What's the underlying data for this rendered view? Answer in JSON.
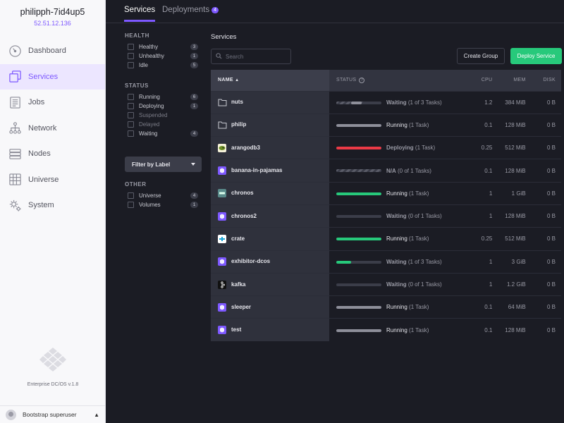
{
  "cluster": {
    "name": "philipph-7id4up5",
    "ip": "52.51.12.136"
  },
  "nav": [
    {
      "label": "Dashboard",
      "icon": "dashboard-icon",
      "active": false
    },
    {
      "label": "Services",
      "icon": "services-icon",
      "active": true
    },
    {
      "label": "Jobs",
      "icon": "jobs-icon",
      "active": false
    },
    {
      "label": "Network",
      "icon": "network-icon",
      "active": false
    },
    {
      "label": "Nodes",
      "icon": "nodes-icon",
      "active": false
    },
    {
      "label": "Universe",
      "icon": "universe-icon",
      "active": false
    },
    {
      "label": "System",
      "icon": "system-icon",
      "active": false
    }
  ],
  "footer": {
    "version": "Enterprise DC/OS v.1.8",
    "user": "Bootstrap superuser"
  },
  "tabs": {
    "services": "Services",
    "deployments": "Deployments",
    "deployments_count": "4"
  },
  "filters": {
    "health_title": "HEALTH",
    "health": [
      {
        "label": "Healthy",
        "count": "3"
      },
      {
        "label": "Unhealthy",
        "count": "1"
      },
      {
        "label": "Idle",
        "count": "5"
      }
    ],
    "status_title": "STATUS",
    "status": [
      {
        "label": "Running",
        "count": "6",
        "muted": false
      },
      {
        "label": "Deploying",
        "count": "1",
        "muted": false
      },
      {
        "label": "Suspended",
        "count": "",
        "muted": true
      },
      {
        "label": "Delayed",
        "count": "",
        "muted": true
      },
      {
        "label": "Waiting",
        "count": "4",
        "muted": false
      }
    ],
    "label_button": "Filter by Label",
    "other_title": "OTHER",
    "other": [
      {
        "label": "Universe",
        "count": "4"
      },
      {
        "label": "Volumes",
        "count": "1"
      }
    ]
  },
  "main": {
    "title": "Services",
    "search_placeholder": "Search",
    "create_group": "Create Group",
    "deploy_service": "Deploy Service"
  },
  "table": {
    "headers": {
      "name": "NAME",
      "status": "STATUS",
      "cpu": "CPU",
      "mem": "MEM",
      "disk": "DISK"
    },
    "rows": [
      {
        "name": "nuts",
        "icon": "folder-icon",
        "progress": 0.6,
        "bar": "stripes-partial",
        "state": "Waiting",
        "detail": "(1 of 3 Tasks)",
        "cpu": "1.2",
        "mem": "384 MiB",
        "disk": "0 B"
      },
      {
        "name": "philip",
        "icon": "folder-icon",
        "progress": 1,
        "bar": "gray",
        "state": "Running",
        "detail": "(1 Task)",
        "cpu": "0.1",
        "mem": "128 MiB",
        "disk": "0 B"
      },
      {
        "name": "arangodb3",
        "icon": "arangodb-icon",
        "progress": 1,
        "bar": "red",
        "state": "Deploying",
        "detail": "(1 Task)",
        "cpu": "0.25",
        "mem": "512 MiB",
        "disk": "0 B"
      },
      {
        "name": "banana-in-pajamas",
        "icon": "cube-icon",
        "progress": 1,
        "bar": "stripes",
        "state": "N/A",
        "detail": "(0 of 1 Tasks)",
        "cpu": "0.1",
        "mem": "128 MiB",
        "disk": "0 B"
      },
      {
        "name": "chronos",
        "icon": "chronos-icon",
        "progress": 1,
        "bar": "green",
        "state": "Running",
        "detail": "(1 Task)",
        "cpu": "1",
        "mem": "1 GiB",
        "disk": "0 B"
      },
      {
        "name": "chronos2",
        "icon": "cube-icon",
        "progress": 0,
        "bar": "empty",
        "state": "Waiting",
        "detail": "(0 of 1 Tasks)",
        "cpu": "1",
        "mem": "128 MiB",
        "disk": "0 B"
      },
      {
        "name": "crate",
        "icon": "crate-icon",
        "progress": 1,
        "bar": "green",
        "state": "Running",
        "detail": "(1 Task)",
        "cpu": "0.25",
        "mem": "512 MiB",
        "disk": "0 B"
      },
      {
        "name": "exhibitor-dcos",
        "icon": "cube-icon",
        "progress": 0.33,
        "bar": "green",
        "state": "Waiting",
        "detail": "(1 of 3 Tasks)",
        "cpu": "1",
        "mem": "3 GiB",
        "disk": "0 B"
      },
      {
        "name": "kafka",
        "icon": "kafka-icon",
        "progress": 0,
        "bar": "empty",
        "state": "Waiting",
        "detail": "(0 of 1 Tasks)",
        "cpu": "1",
        "mem": "1.2 GiB",
        "disk": "0 B"
      },
      {
        "name": "sleeper",
        "icon": "cube-icon",
        "progress": 1,
        "bar": "gray",
        "state": "Running",
        "detail": "(1 Task)",
        "cpu": "0.1",
        "mem": "64 MiB",
        "disk": "0 B"
      },
      {
        "name": "test",
        "icon": "cube-icon",
        "progress": 1,
        "bar": "gray",
        "state": "Running",
        "detail": "(1 Task)",
        "cpu": "0.1",
        "mem": "128 MiB",
        "disk": "0 B"
      }
    ]
  },
  "colors": {
    "accent": "#7d58ff",
    "green": "#27c97b",
    "red": "#eb3a46",
    "gray": "#8e8f9a"
  }
}
